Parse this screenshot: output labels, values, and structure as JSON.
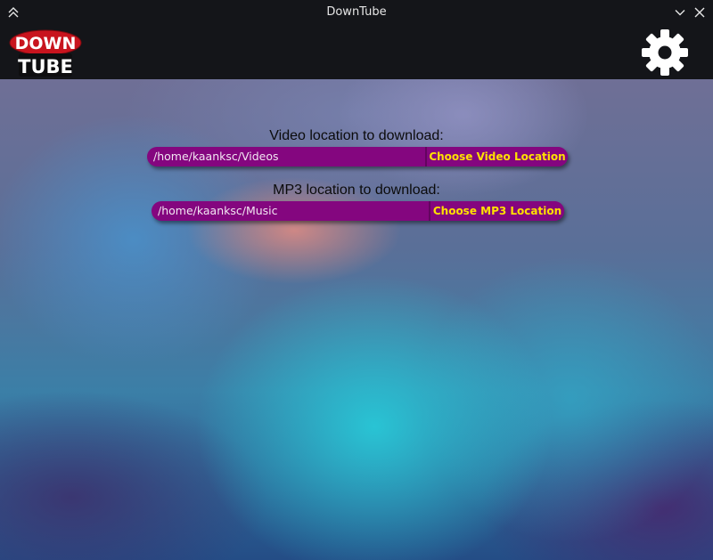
{
  "window": {
    "title": "DownTube"
  },
  "header": {
    "logo_text_top": "DOWN",
    "logo_text_bottom": "TUBE",
    "settings_icon": "gear-icon"
  },
  "video": {
    "label": "Video location to download:",
    "path": "/home/kaanksc/Videos",
    "button_label": "Choose Video Location"
  },
  "mp3": {
    "label": "MP3 location to download:",
    "path": "/home/kaanksc/Music",
    "button_label": "Choose MP3 Location"
  },
  "colors": {
    "accent": "#84067f",
    "button_text": "#ffe100",
    "logo_red": "#c8141e"
  }
}
